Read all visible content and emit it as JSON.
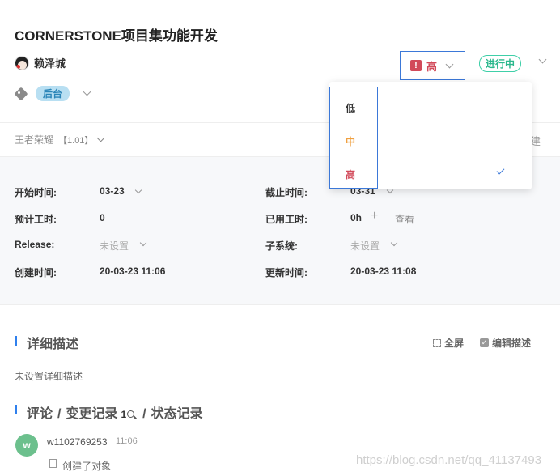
{
  "header": {
    "title": "CORNERSTONE项目集功能开发",
    "assignee": "赖泽城"
  },
  "priority": {
    "icon": "!",
    "label": "高",
    "color": "#d24a5a"
  },
  "status": {
    "label": "进行中",
    "color": "#2bb88d"
  },
  "tag": {
    "label": "后台",
    "color": "#b8dff2"
  },
  "project": {
    "name": "王者荣耀",
    "version": "【1.01】",
    "right_text": "建"
  },
  "info": {
    "start_label": "开始时间:",
    "start_value": "03-23",
    "due_label": "截止时间:",
    "due_value": "03-31",
    "estimate_label": "预计工时:",
    "estimate_value": "0",
    "used_label": "已用工时:",
    "used_value": "0h",
    "used_plus": "+",
    "view_label": "查看",
    "release_label": "Release:",
    "release_value": "未设置",
    "subsystem_label": "子系统:",
    "subsystem_value": "未设置",
    "created_label": "创建时间:",
    "created_value": "20-03-23 11:06",
    "updated_label": "更新时间:",
    "updated_value": "20-03-23 11:08"
  },
  "description": {
    "title": "详细描述",
    "fullscreen_label": "全屏",
    "edit_label": "编辑描述",
    "empty_text": "未设置详细描述"
  },
  "activity": {
    "tab_comments": "评论",
    "separator": "/",
    "tab_changes": "变更记录",
    "change_count": "1",
    "tab_status": "状态记录",
    "avatar_letter": "w",
    "user": "w1102769253",
    "time": "11:06",
    "action": "创建了对象"
  },
  "priority_dropdown": {
    "options": [
      {
        "label": "低",
        "color": "#333333"
      },
      {
        "label": "中",
        "color": "#f0a040"
      },
      {
        "label": "高",
        "color": "#d24a5a"
      }
    ],
    "selected": "高"
  },
  "watermark": "https://blog.csdn.net/qq_41137493"
}
